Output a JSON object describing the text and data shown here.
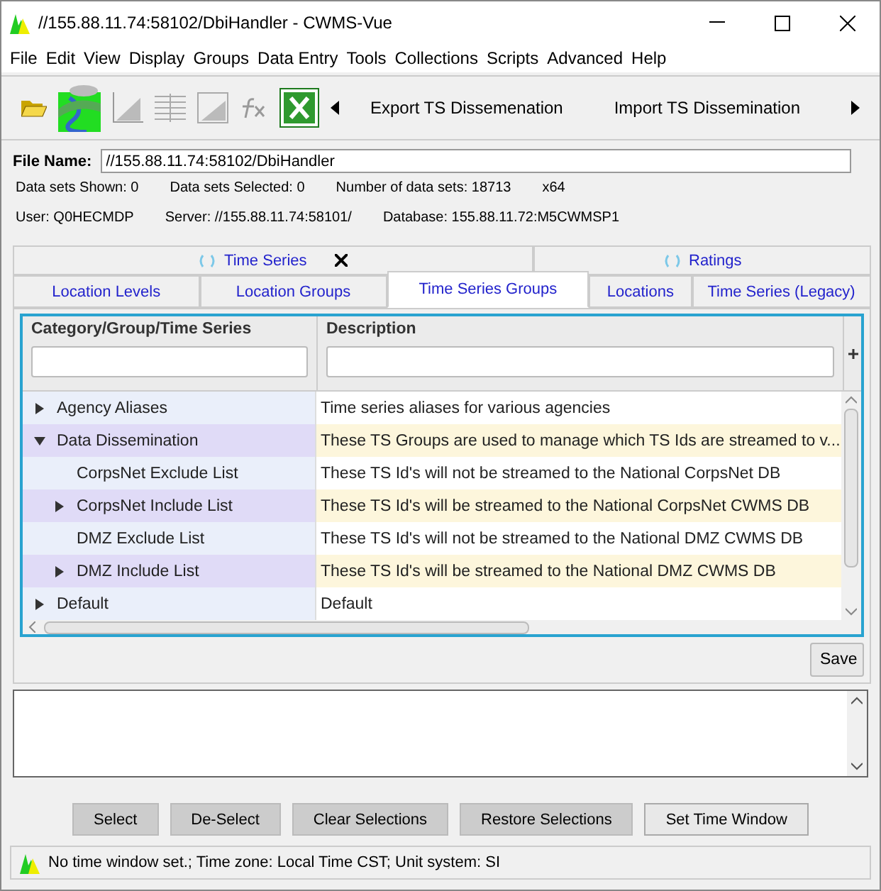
{
  "window": {
    "title": "//155.88.11.74:58102/DbiHandler - CWMS-Vue"
  },
  "menu": [
    "File",
    "Edit",
    "View",
    "Display",
    "Groups",
    "Data Entry",
    "Tools",
    "Collections",
    "Scripts",
    "Advanced",
    "Help"
  ],
  "toolbar": {
    "buttons": [
      "Export TS Dissemenation",
      "Import TS Dissemination"
    ]
  },
  "file_name": {
    "label": "File Name:",
    "value": "//155.88.11.74:58102/DbiHandler"
  },
  "info_lines": [
    [
      "Data sets Shown:  0",
      "Data sets Selected: 0",
      "Number of data sets:  18713",
      "x64"
    ],
    [
      "User: Q0HECMDP",
      "Server: //155.88.11.74:58101/",
      "Database: 155.88.11.72:M5CWMSP1"
    ]
  ],
  "tabs_top": [
    {
      "label": "Time Series",
      "closable": true
    },
    {
      "label": "Ratings",
      "closable": false
    }
  ],
  "tabs": [
    {
      "label": "Location Levels",
      "selected": false
    },
    {
      "label": "Location Groups",
      "selected": false
    },
    {
      "label": "Time Series Groups",
      "selected": true
    },
    {
      "label": "Locations",
      "selected": false
    },
    {
      "label": "Time Series (Legacy)",
      "selected": false
    }
  ],
  "table": {
    "columns": [
      "Category/Group/Time Series",
      "Description"
    ],
    "rows": [
      {
        "name": "Agency Aliases",
        "description": "Time series aliases for various agencies",
        "kind": "folder",
        "expanded": false
      },
      {
        "name": "Data Dissemination",
        "description": "These TS Groups are used to manage which TS Ids are streamed to v...",
        "kind": "folder",
        "expanded": true,
        "children": [
          {
            "name": "CorpsNet Exclude List",
            "description": "These TS Id's will not be streamed to the National CorpsNet DB",
            "kind": "leaf",
            "expanded": false
          },
          {
            "name": "CorpsNet Include List",
            "description": "These TS Id's will be streamed to the National CorpsNet CWMS DB",
            "kind": "folder",
            "expanded": false
          },
          {
            "name": "DMZ Exclude List",
            "description": "These TS Id's will not be streamed to the National DMZ CWMS DB",
            "kind": "leaf",
            "expanded": false
          },
          {
            "name": "DMZ Include List",
            "description": "These TS Id's will be streamed to the National DMZ CWMS DB",
            "kind": "folder",
            "expanded": false
          }
        ]
      },
      {
        "name": "Default",
        "description": "Default",
        "kind": "folder",
        "expanded": false
      }
    ]
  },
  "save_button": "Save",
  "buttons": [
    "Select",
    "De-Select",
    "Clear Selections",
    "Restore Selections",
    "Set Time Window"
  ],
  "status_bar": "No time window set.;  Time zone: Local Time CST;  Unit system: SI"
}
